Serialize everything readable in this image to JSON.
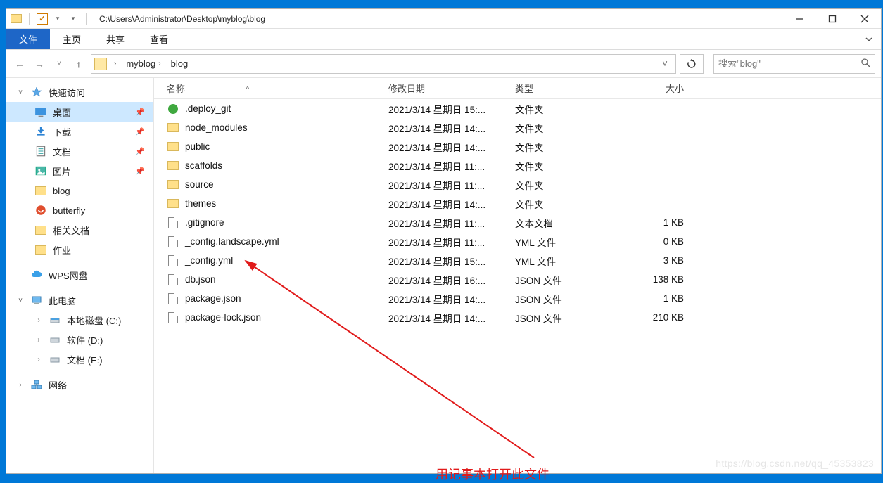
{
  "title_path": "C:\\Users\\Administrator\\Desktop\\myblog\\blog",
  "ribbon": {
    "file": "文件",
    "home": "主页",
    "share": "共享",
    "view": "查看"
  },
  "breadcrumbs": [
    "myblog",
    "blog"
  ],
  "search_placeholder": "搜索\"blog\"",
  "columns": {
    "name": "名称",
    "date": "修改日期",
    "type": "类型",
    "size": "大小"
  },
  "sidebar": {
    "quick_access": "快速访问",
    "items": [
      {
        "label": "桌面",
        "icon": "desktop",
        "pinned": true,
        "selected": true
      },
      {
        "label": "下载",
        "icon": "downloads",
        "pinned": true
      },
      {
        "label": "文档",
        "icon": "docs",
        "pinned": true
      },
      {
        "label": "图片",
        "icon": "pics",
        "pinned": true
      },
      {
        "label": "blog",
        "icon": "folder"
      },
      {
        "label": "butterfly",
        "icon": "greencircle"
      },
      {
        "label": "相关文档",
        "icon": "folder"
      },
      {
        "label": "作业",
        "icon": "folder"
      }
    ],
    "wps": "WPS网盘",
    "this_pc": "此电脑",
    "drives": [
      {
        "label": "本地磁盘 (C:)"
      },
      {
        "label": "软件 (D:)"
      },
      {
        "label": "文档 (E:)"
      }
    ],
    "network": "网络"
  },
  "files": [
    {
      "name": ".deploy_git",
      "date": "2021/3/14 星期日 15:...",
      "type": "文件夹",
      "size": "",
      "icon": "green"
    },
    {
      "name": "node_modules",
      "date": "2021/3/14 星期日 14:...",
      "type": "文件夹",
      "size": "",
      "icon": "folder"
    },
    {
      "name": "public",
      "date": "2021/3/14 星期日 14:...",
      "type": "文件夹",
      "size": "",
      "icon": "folder"
    },
    {
      "name": "scaffolds",
      "date": "2021/3/14 星期日 11:...",
      "type": "文件夹",
      "size": "",
      "icon": "folder"
    },
    {
      "name": "source",
      "date": "2021/3/14 星期日 11:...",
      "type": "文件夹",
      "size": "",
      "icon": "folder"
    },
    {
      "name": "themes",
      "date": "2021/3/14 星期日 14:...",
      "type": "文件夹",
      "size": "",
      "icon": "folder"
    },
    {
      "name": ".gitignore",
      "date": "2021/3/14 星期日 11:...",
      "type": "文本文档",
      "size": "1 KB",
      "icon": "doc"
    },
    {
      "name": "_config.landscape.yml",
      "date": "2021/3/14 星期日 11:...",
      "type": "YML 文件",
      "size": "0 KB",
      "icon": "doc"
    },
    {
      "name": "_config.yml",
      "date": "2021/3/14 星期日 15:...",
      "type": "YML 文件",
      "size": "3 KB",
      "icon": "doc"
    },
    {
      "name": "db.json",
      "date": "2021/3/14 星期日 16:...",
      "type": "JSON 文件",
      "size": "138 KB",
      "icon": "doc"
    },
    {
      "name": "package.json",
      "date": "2021/3/14 星期日 14:...",
      "type": "JSON 文件",
      "size": "1 KB",
      "icon": "doc"
    },
    {
      "name": "package-lock.json",
      "date": "2021/3/14 星期日 14:...",
      "type": "JSON 文件",
      "size": "210 KB",
      "icon": "doc"
    }
  ],
  "annotation_text": "用记事本打开此文件",
  "watermark": "https://blog.csdn.net/qq_45353823"
}
